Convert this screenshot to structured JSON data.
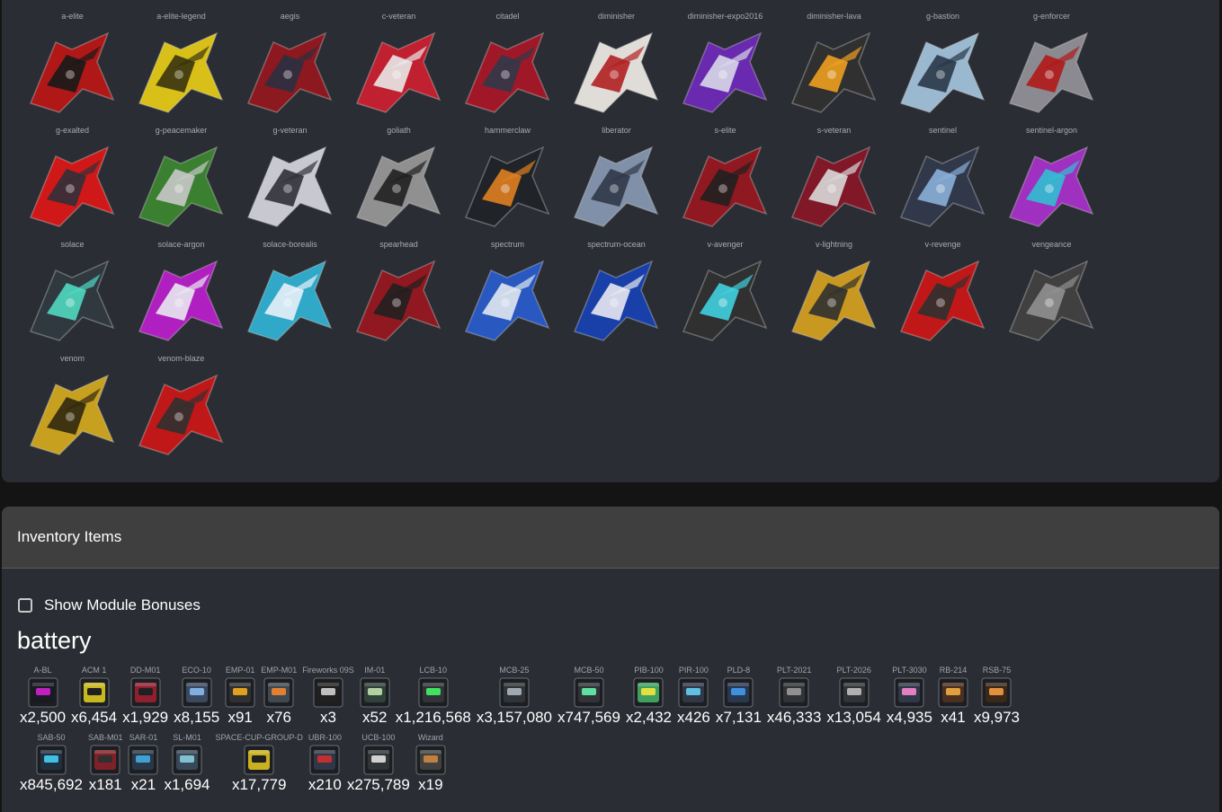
{
  "ships": [
    {
      "name": "a-elite",
      "colors": [
        "#b01818",
        "#1a1a1a"
      ]
    },
    {
      "name": "a-elite-legend",
      "colors": [
        "#d8c018",
        "#3a3410"
      ]
    },
    {
      "name": "aegis",
      "colors": [
        "#8c1820",
        "#2a3040"
      ]
    },
    {
      "name": "c-veteran",
      "colors": [
        "#c02030",
        "#e8e8e8"
      ]
    },
    {
      "name": "citadel",
      "colors": [
        "#a01828",
        "#303848"
      ]
    },
    {
      "name": "diminisher",
      "colors": [
        "#e0dcd8",
        "#b02020"
      ]
    },
    {
      "name": "diminisher-expo2016",
      "colors": [
        "#6a2ab0",
        "#d8d8e8"
      ]
    },
    {
      "name": "diminisher-lava",
      "colors": [
        "#303030",
        "#f0a020"
      ]
    },
    {
      "name": "g-bastion",
      "colors": [
        "#9ab8d0",
        "#2a3848"
      ]
    },
    {
      "name": "g-enforcer",
      "colors": [
        "#8a8a90",
        "#b01818"
      ]
    },
    {
      "name": "g-exalted",
      "colors": [
        "#d01818",
        "#303038"
      ]
    },
    {
      "name": "g-peacemaker",
      "colors": [
        "#3a8030",
        "#c8c8c8"
      ]
    },
    {
      "name": "g-veteran",
      "colors": [
        "#c8c8d0",
        "#303038"
      ]
    },
    {
      "name": "goliath",
      "colors": [
        "#909090",
        "#202020"
      ]
    },
    {
      "name": "hammerclaw",
      "colors": [
        "#202428",
        "#e08020"
      ]
    },
    {
      "name": "liberator",
      "colors": [
        "#8090a8",
        "#303848"
      ]
    },
    {
      "name": "s-elite",
      "colors": [
        "#901820",
        "#202020"
      ]
    },
    {
      "name": "s-veteran",
      "colors": [
        "#801828",
        "#d8d8d8"
      ]
    },
    {
      "name": "sentinel",
      "colors": [
        "#30384a",
        "#8ab0d8"
      ]
    },
    {
      "name": "sentinel-argon",
      "colors": [
        "#a030c0",
        "#30c0d0"
      ]
    },
    {
      "name": "solace",
      "colors": [
        "#303840",
        "#50d8c0"
      ]
    },
    {
      "name": "solace-argon",
      "colors": [
        "#b020c0",
        "#e8e8f0"
      ]
    },
    {
      "name": "solace-borealis",
      "colors": [
        "#30a8c8",
        "#e8f0f8"
      ]
    },
    {
      "name": "spearhead",
      "colors": [
        "#901820",
        "#202020"
      ]
    },
    {
      "name": "spectrum",
      "colors": [
        "#2858c0",
        "#e0e8f0"
      ]
    },
    {
      "name": "spectrum-ocean",
      "colors": [
        "#1840a8",
        "#e8e8f0"
      ]
    },
    {
      "name": "v-avenger",
      "colors": [
        "#303030",
        "#40d0e0"
      ]
    },
    {
      "name": "v-lightning",
      "colors": [
        "#c89820",
        "#303030"
      ]
    },
    {
      "name": "v-revenge",
      "colors": [
        "#c01818",
        "#303030"
      ]
    },
    {
      "name": "vengeance",
      "colors": [
        "#404040",
        "#909090"
      ]
    },
    {
      "name": "venom",
      "colors": [
        "#c8a020",
        "#302810"
      ]
    },
    {
      "name": "venom-blaze",
      "colors": [
        "#c01818",
        "#303030"
      ]
    }
  ],
  "inventory": {
    "title": "Inventory Items",
    "show_bonuses_label": "Show Module Bonuses",
    "category": "battery",
    "rows": [
      [
        {
          "code": "A-BL",
          "count": "x2,500",
          "colors": [
            "#1a1a22",
            "#c020c0"
          ]
        },
        {
          "code": "ACM 1",
          "count": "x6,454",
          "colors": [
            "#c8b820",
            "#202020"
          ]
        },
        {
          "code": "DD-M01",
          "count": "x1,929",
          "colors": [
            "#902030",
            "#202020"
          ]
        },
        {
          "code": "ECO-10",
          "count": "x8,155",
          "colors": [
            "#3a4860",
            "#80b0e0"
          ]
        },
        {
          "code": "EMP-01",
          "count": "x91",
          "colors": [
            "#303030",
            "#e0a020"
          ]
        },
        {
          "code": "EMP-M01",
          "count": "x76",
          "colors": [
            "#404850",
            "#e08030"
          ]
        },
        {
          "code": "Fireworks 09S",
          "count": "x3",
          "colors": [
            "#202020",
            "#c0c0c0"
          ]
        },
        {
          "code": "IM-01",
          "count": "x52",
          "colors": [
            "#30403a",
            "#b0d0a0"
          ]
        },
        {
          "code": "LCB-10",
          "count": "x1,216,568",
          "colors": [
            "#303438",
            "#40e060"
          ]
        },
        {
          "code": "MCB-25",
          "count": "x3,157,080",
          "colors": [
            "#303438",
            "#a0a8b0"
          ]
        },
        {
          "code": "MCB-50",
          "count": "x747,569",
          "colors": [
            "#303438",
            "#60e0a0"
          ]
        },
        {
          "code": "PIB-100",
          "count": "x2,432",
          "colors": [
            "#40a060",
            "#e0e040"
          ]
        },
        {
          "code": "PIR-100",
          "count": "x426",
          "colors": [
            "#303848",
            "#60c0e0"
          ]
        },
        {
          "code": "PLD-8",
          "count": "x7,131",
          "colors": [
            "#283850",
            "#4090e0"
          ]
        },
        {
          "code": "PLT-2021",
          "count": "x46,333",
          "colors": [
            "#303438",
            "#909090"
          ]
        },
        {
          "code": "PLT-2026",
          "count": "x13,054",
          "colors": [
            "#303438",
            "#b0b0b0"
          ]
        },
        {
          "code": "PLT-3030",
          "count": "x4,935",
          "colors": [
            "#303848",
            "#e080c0"
          ]
        },
        {
          "code": "RB-214",
          "count": "x41",
          "colors": [
            "#4a3020",
            "#e0a040"
          ]
        },
        {
          "code": "RSB-75",
          "count": "x9,973",
          "colors": [
            "#3a2818",
            "#e09040"
          ]
        }
      ],
      [
        {
          "code": "SAB-50",
          "count": "x845,692",
          "colors": [
            "#203040",
            "#40c0e0"
          ]
        },
        {
          "code": "SAB-M01",
          "count": "x181",
          "colors": [
            "#802028",
            "#303030"
          ]
        },
        {
          "code": "SAR-01",
          "count": "x21",
          "colors": [
            "#283848",
            "#40a0d0"
          ]
        },
        {
          "code": "SL-M01",
          "count": "x1,694",
          "colors": [
            "#384858",
            "#80c0d0"
          ]
        },
        {
          "code": "SPACE-CUP-GROUP-D",
          "count": "x17,779",
          "colors": [
            "#c8b020",
            "#202020"
          ]
        },
        {
          "code": "UBR-100",
          "count": "x210",
          "colors": [
            "#303848",
            "#c03030"
          ]
        },
        {
          "code": "UCB-100",
          "count": "x275,789",
          "colors": [
            "#303438",
            "#d0d0d0"
          ]
        },
        {
          "code": "Wizard",
          "count": "x19",
          "colors": [
            "#404040",
            "#c08040"
          ]
        }
      ]
    ]
  }
}
